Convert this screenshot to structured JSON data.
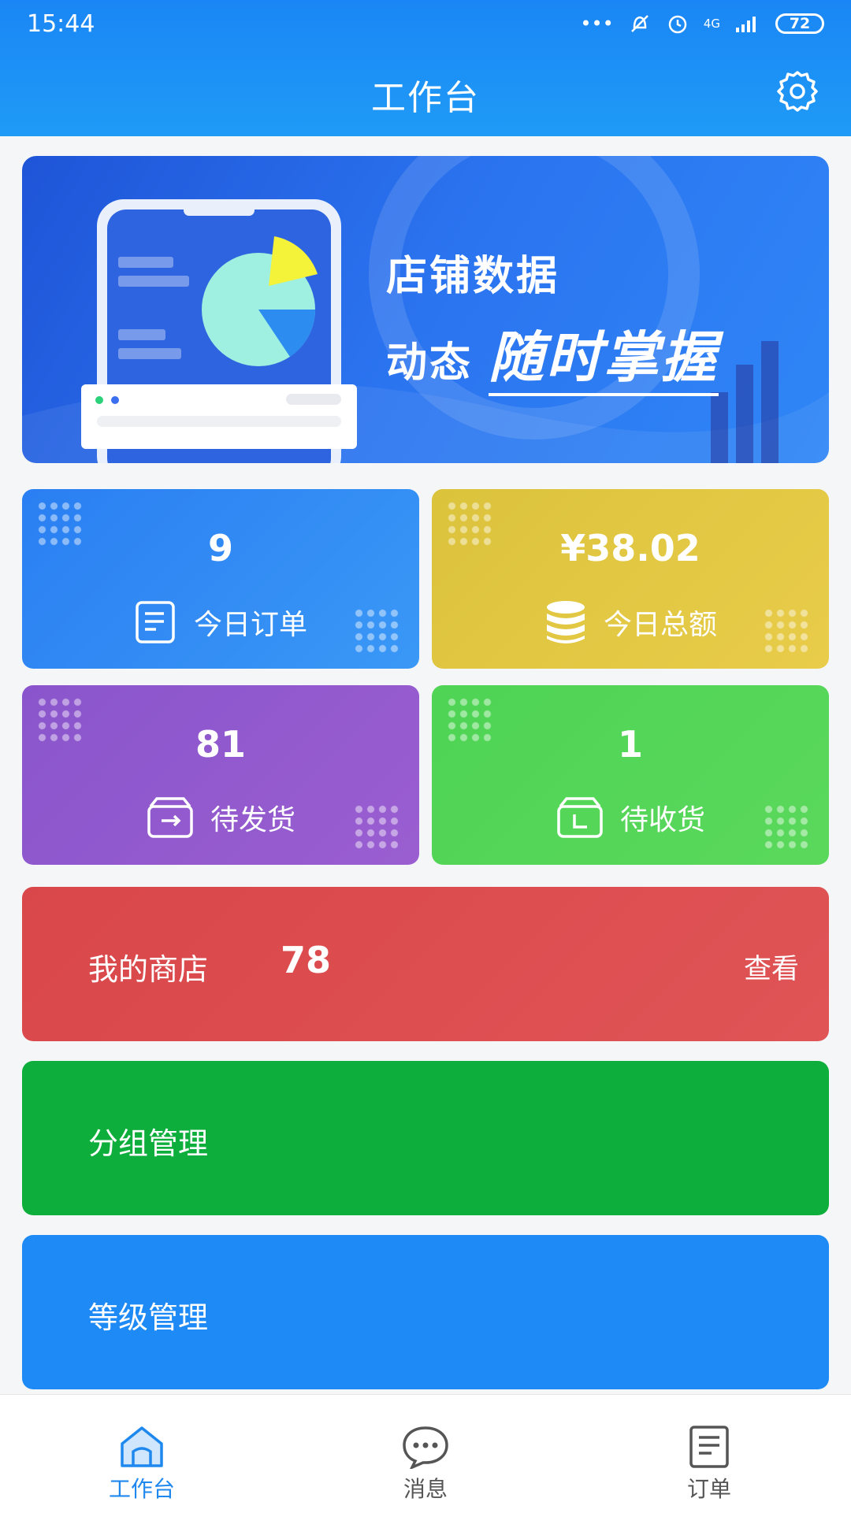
{
  "status_bar": {
    "time": "15:44",
    "network": "4G",
    "battery": "72"
  },
  "header": {
    "title": "工作台"
  },
  "banner": {
    "line1": "店铺数据",
    "line2_prefix": "动态",
    "line2_emphasis": "随时掌握"
  },
  "stats": [
    {
      "value": "9",
      "label": "今日订单",
      "color": "#2b87f3"
    },
    {
      "value": "¥38.02",
      "label": "今日总额",
      "color": "#e1c43e"
    },
    {
      "value": "81",
      "label": "待发货",
      "color": "#9055c9"
    },
    {
      "value": "1",
      "label": "待收货",
      "color": "#4ed454"
    }
  ],
  "shop_card": {
    "label": "我的商店",
    "count": "78",
    "action": "查看",
    "color": "#dc4a4c"
  },
  "group_card": {
    "label": "分组管理",
    "color": "#0eaf3d"
  },
  "level_card": {
    "label": "等级管理",
    "color": "#1d8af5"
  },
  "tabs": [
    {
      "label": "工作台",
      "active": true
    },
    {
      "label": "消息",
      "active": false
    },
    {
      "label": "订单",
      "active": false
    }
  ]
}
